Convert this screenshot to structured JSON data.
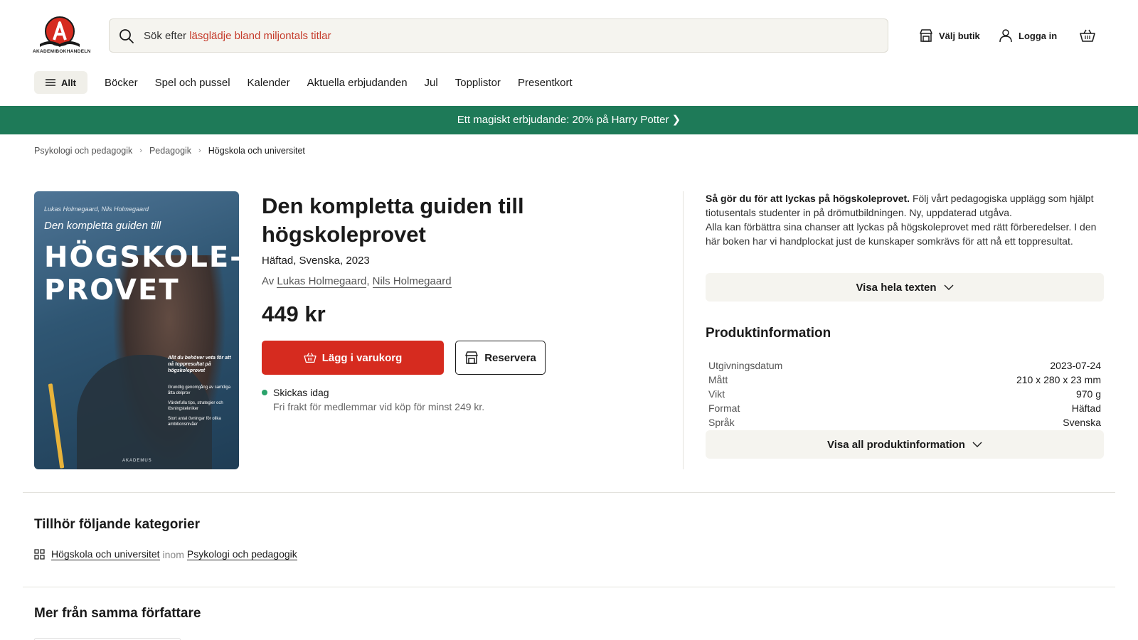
{
  "header": {
    "logo_text": "AKADEMIBOKHANDELN",
    "search": {
      "prefix": "Sök efter ",
      "highlight": "läsglädje bland miljontals titlar"
    },
    "actions": {
      "store": "Välj butik",
      "login": "Logga in"
    }
  },
  "nav": {
    "all_label": "Allt",
    "items": [
      "Böcker",
      "Spel och pussel",
      "Kalender",
      "Aktuella erbjudanden",
      "Jul",
      "Topplistor",
      "Presentkort"
    ]
  },
  "banner": {
    "text": "Ett magiskt erbjudande: 20% på Harry Potter ❯"
  },
  "breadcrumb": [
    "Psykologi och pedagogik",
    "Pedagogik",
    "Högskola och universitet"
  ],
  "cover": {
    "authors": "Lukas Holmegaard, Nils Holmegaard",
    "subtitle": "Den kompletta guiden till",
    "big_line1": "HÖGSKOLE-",
    "big_line2": "PROVET",
    "blurb": "Allt du behöver veta för att nå toppresultat på högskoleprovet",
    "bullets": [
      "Grundlig genomgång av samtliga åtta delprov",
      "Värdefulla tips, strategier och lösningstekniker",
      "Stort antal övningar för olika ambitionsnivåer"
    ],
    "publisher": "AKADEMUS"
  },
  "product": {
    "title": "Den kompletta guiden till högskoleprovet",
    "meta": "Häftad, Svenska, 2023",
    "by": "Av",
    "author1": "Lukas Holmegaard",
    "author_sep": ",",
    "author2": "Nils Holmegaard",
    "price": "449 kr",
    "add_to_cart": "Lägg i varukorg",
    "reserve": "Reservera",
    "shipping": "Skickas idag",
    "freight": "Fri frakt för medlemmar vid köp för minst 249 kr."
  },
  "description": {
    "bold": "Så gör du för att lyckas på högskoleprovet.",
    "text1": " Följ vårt pedagogiska upplägg som hjälpt tiotusentals studenter in på drömutbildningen. Ny, uppdaterad utgåva.",
    "text2": "Alla kan förbättra sina chanser att lyckas på högskoleprovet med rätt förberedelser. I den här boken har vi handplockat just de kunskaper somkrävs för att nå ett toppresultat.",
    "show_more": "Visa hela texten"
  },
  "product_info": {
    "title": "Produktinformation",
    "rows": [
      {
        "key": "Utgivningsdatum",
        "value": "2023-07-24"
      },
      {
        "key": "Mått",
        "value": "210 x 280 x 23 mm"
      },
      {
        "key": "Vikt",
        "value": "970 g"
      },
      {
        "key": "Format",
        "value": "Häftad"
      },
      {
        "key": "Språk",
        "value": "Svenska"
      }
    ],
    "show_all": "Visa all produktinformation"
  },
  "categories": {
    "title": "Tillhör följande kategorier",
    "category": "Högskola och universitet",
    "inom": "inom",
    "parent": "Psykologi och pedagogik"
  },
  "more_from_author": {
    "title": "Mer från samma författare"
  },
  "colors": {
    "accent_red": "#d62b1f",
    "banner_green": "#1e7a58",
    "search_highlight": "#c53b2b",
    "in_stock": "#2aa36b"
  }
}
